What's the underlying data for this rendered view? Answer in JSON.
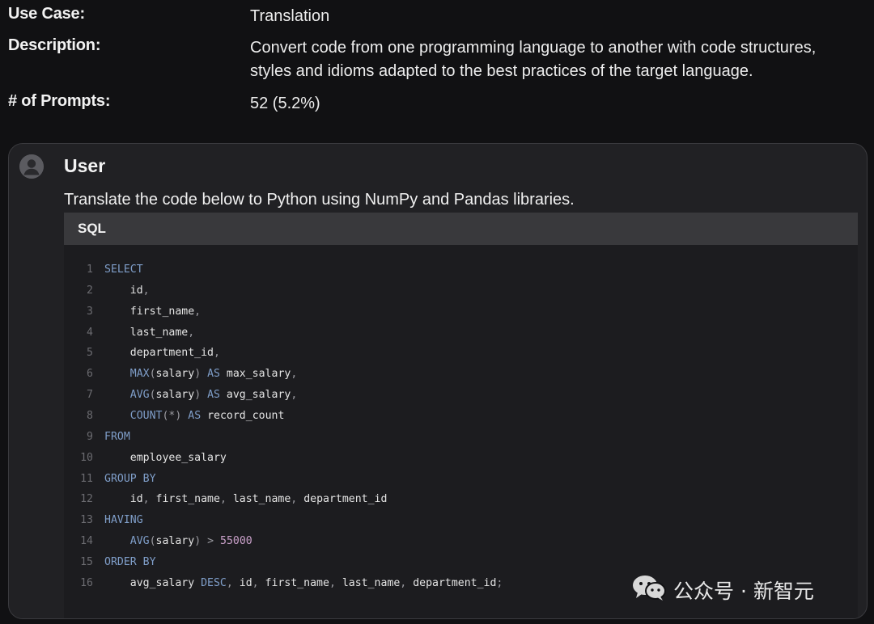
{
  "meta": {
    "use_case_label": "Use Case:",
    "use_case_value": "Translation",
    "description_label": "Description:",
    "description_value_line1": "Convert code from one programming language to another with code structures,",
    "description_value_line2": "styles and idioms adapted to the best practices of the target language.",
    "prompts_label": "# of Prompts:",
    "prompts_value": "52 (5.2%)"
  },
  "message": {
    "role": "User",
    "avatar_icon": "user-avatar-icon",
    "prompt": "Translate the code below to Python using NumPy and Pandas libraries.",
    "code_language": "SQL",
    "code_lines": [
      {
        "n": "1",
        "text": "SELECT"
      },
      {
        "n": "2",
        "text": "    id,"
      },
      {
        "n": "3",
        "text": "    first_name,"
      },
      {
        "n": "4",
        "text": "    last_name,"
      },
      {
        "n": "5",
        "text": "    department_id,"
      },
      {
        "n": "6",
        "text": "    MAX(salary) AS max_salary,"
      },
      {
        "n": "7",
        "text": "    AVG(salary) AS avg_salary,"
      },
      {
        "n": "8",
        "text": "    COUNT(*) AS record_count"
      },
      {
        "n": "9",
        "text": "FROM"
      },
      {
        "n": "10",
        "text": "    employee_salary"
      },
      {
        "n": "11",
        "text": "GROUP BY"
      },
      {
        "n": "12",
        "text": "    id, first_name, last_name, department_id"
      },
      {
        "n": "13",
        "text": "HAVING"
      },
      {
        "n": "14",
        "text": "    AVG(salary) > 55000"
      },
      {
        "n": "15",
        "text": "ORDER BY"
      },
      {
        "n": "16",
        "text": "    avg_salary DESC, id, first_name, last_name, department_id;"
      }
    ]
  },
  "watermark": {
    "icon": "wechat-icon",
    "text": "公众号 · 新智元"
  },
  "colors": {
    "background": "#111113",
    "card": "#212124",
    "code_header": "#39393c",
    "code_body": "#1c1c1f",
    "keyword": "#7f9ec9",
    "number": "#c9a0c9"
  }
}
